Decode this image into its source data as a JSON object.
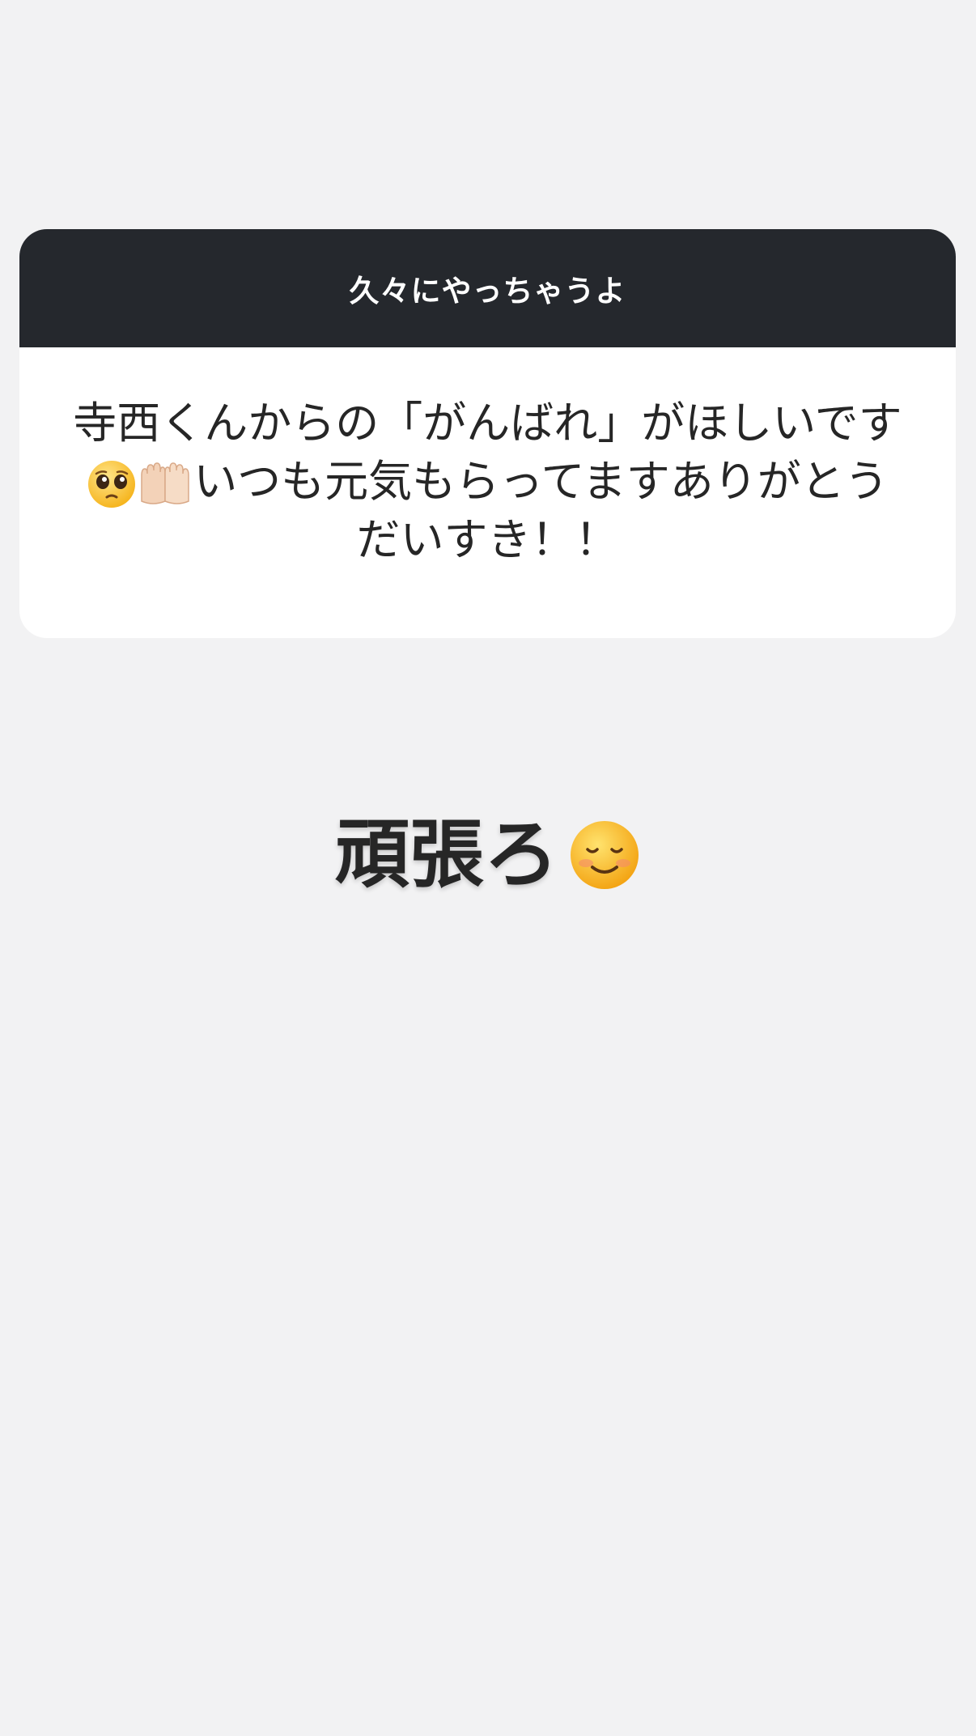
{
  "header": {
    "title": "久々にやっちゃうよ"
  },
  "question": {
    "line1": "寺西くんからの「がんばれ」がほしいです",
    "line2_emojis": [
      "pleading-face-emoji",
      "palms-up-together-emoji"
    ],
    "line2_text": "いつも元気もらってますありがとう",
    "line3": "だいすき！！"
  },
  "answer": {
    "text": "頑張ろ",
    "emoji": "smiling-face-emoji"
  },
  "colors": {
    "background": "#f2f2f3",
    "header_bg": "#25282d",
    "card_bg": "#ffffff",
    "text": "#262626"
  }
}
